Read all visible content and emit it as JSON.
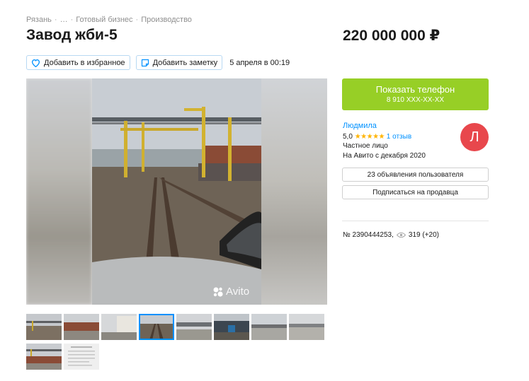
{
  "breadcrumb": [
    "Рязань",
    "…",
    "Готовый бизнес",
    "Производство"
  ],
  "breadcrumb_sep": "·",
  "title": "Завод жби-5",
  "price": "220 000 000 ₽",
  "actions": {
    "favorite": "Добавить в избранное",
    "note": "Добавить заметку",
    "date": "5 апреля в 00:19"
  },
  "gallery": {
    "watermark": "Avito",
    "thumb_count": 10,
    "active_thumb": 4
  },
  "contact": {
    "label": "Показать телефон",
    "phone": "8 910 XXX-XX-XX",
    "color": "#97cf26"
  },
  "seller": {
    "name": "Людмила",
    "rating": "5,0",
    "stars": "★★★★★",
    "reviews": "1 отзыв",
    "type": "Частное лицо",
    "since": "На Авито с декабря 2020",
    "avatar_letter": "Л",
    "avatar_color": "#e8474c"
  },
  "buttons": {
    "listings": "23 объявления пользователя",
    "subscribe": "Подписаться на продавца"
  },
  "meta": {
    "id": "№ 2390444253,",
    "views": "319 (+20)"
  }
}
